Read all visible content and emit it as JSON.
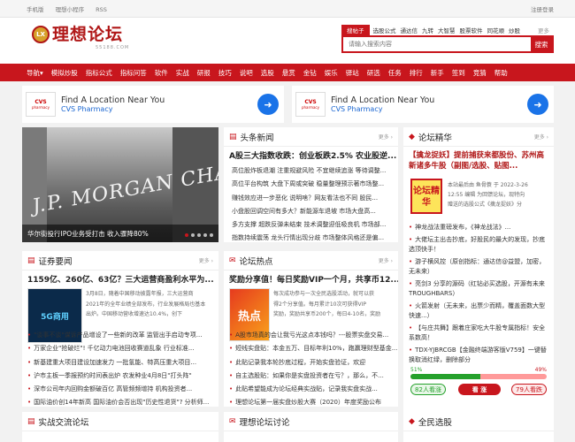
{
  "topbar": {
    "links": [
      "手机版",
      "理想小程序",
      "RSS"
    ],
    "right": "注册登录"
  },
  "logo": {
    "badge": "LX",
    "name": "理想论坛",
    "sub": "55188.COM"
  },
  "search": {
    "tabs": [
      "搜帖子",
      "选股公式",
      "通达信",
      "九转",
      "大智慧",
      "股票软件",
      "同花顺",
      "炒股"
    ],
    "more": "更多",
    "placeholder": "请输入搜索内容",
    "button": "搜索"
  },
  "nav": [
    "导航▾",
    "模拟炒股",
    "指标公式",
    "指标问答",
    "软件",
    "实战",
    "研报",
    "技巧",
    "说吧",
    "选股",
    "悬赏",
    "金钻",
    "娱乐",
    "驿站",
    "研选",
    "任务",
    "排行",
    "新手",
    "签到",
    "竞猜",
    "帮助"
  ],
  "ads": [
    {
      "logo": "CVS",
      "logo_sub": "pharmacy",
      "title": "Find A Location Near You",
      "sub": "CVS Pharmacy"
    },
    {
      "logo": "CVS",
      "logo_sub": "pharmacy",
      "title": "Find A Location Near You",
      "sub": "CVS Pharmacy"
    }
  ],
  "hero": {
    "text": "J.P. MORGAN CHASE & CO.",
    "caption": "华尔街投行IPO业务受打击 收入骤降80%"
  },
  "news": {
    "title": "头条新闻",
    "more": "更多 ›",
    "headline": "A股三大指数收跌：创业板跌2.5% 农业股逆...",
    "items": [
      "高位股炸板退潮 注重规避风险 不宜继续追涨 等待调整...",
      "高位平台构筑 大盘下周或突破 稳量整理预示著市场整...",
      "赚钱效应进一步恶化 说明啥？网友看法也不同 股民...",
      "小盘股回调空间有多大？新能源车退坡 市场大盘高...",
      "多方支撑 超跌反弹未结束 技术调整迎低吸良机 市场部...",
      "指数持续震荡 龙头行情出现分歧 市场整体风格还是偏..."
    ]
  },
  "elite": {
    "title": "论坛精华",
    "more": "更多 ›",
    "headline": "【擒龙捉妖】提前捕获来都股份、苏州高新诸多牛股（副图/选股、贴图...",
    "img": "论坛精华",
    "meta": [
      "本站最后由 鱼骨蓑 于 2022-3-26",
      "12:55 编辑 为回馈论坛，现特向",
      "赠送的选股公式《擒龙捉妖》分"
    ],
    "items": [
      "神龙战法重磅发布，《神龙战法》...",
      "大佬坛主出击抄底，好股民的最大的发现，抄底选顶快手！",
      "游子横风控（原创指标：通达信@益盟，加密，无未来）",
      "亮剑3 分享的源码（红钻必买选股，开源有未来TROUGHBARS）",
      "火箭发射（无未来，出票少而精，覆盖面数大型快速...）",
      "【与庄共舞】跟着庄家吃大牛股专属指标！安全系数高！",
      "TDX-YJBRCGB【金融终端游客版V759】一键替换取消红绿，删除部分"
    ],
    "progress": {
      "green": "51%",
      "red": "49%",
      "green_frac": 0.51
    },
    "buttons": {
      "left": "82人看涨",
      "mid": "看 涨",
      "right": "79人看跌"
    }
  },
  "sec": {
    "title": "证券要闻",
    "more": "更多 ›",
    "headline": "1159亿、260亿、63亿？三大运营商盈利水平为...",
    "img": "5G商用",
    "summary": [
      "3月8日，随着中国移动披露年报，三大运营商",
      "2021年的全年业绩全部发布，行业发展格局也基本",
      "出炉。中国移动营收增速达10.4%，创下"
    ],
    "items": [
      "\"谈事不谈\"谋诉产品增设了一些新的改革 监管出手启动专项...",
      "万家企业\"抢破烂\"! 千亿动力电池回收赛道乱象 行业标准...",
      "新基建重大项目建设加速发力 一批氢能、特高压重大项目...",
      "沪市主板一季报预约时间表出炉 农发种业4月8日\"打头阵\"",
      "深市公司年内回购金额破百亿 高管频频增持 机构投资者...",
      "国际油价创14年新高 国际油价会否出现\"历史性退货\"? 分析师..."
    ]
  },
  "hot": {
    "title": "论坛热点",
    "more": "更多 ›",
    "headline": "奖励分享值！每日奖励VIP一个月，共享币12...",
    "img": "热点",
    "summary": [
      "每次成功参与一次全民选股活动，就可以获",
      "得2个分享值。每月累计10次可获得VIP",
      "奖励，奖励共享币200个，每日4-10名，奖励"
    ],
    "items": [
      "A股市场真的会让我亏光这点本钱吗？---股票实盘交易...",
      "短线实盘贴：本金五万、目标年利10%，跑赢理财型基金...",
      "此贴记录我本轮抄底过程，开始实盘验证，欢迎",
      "自主选股贴：如果你是实盘投资者在亏？，那么，不...",
      "此贴希望能成为论坛经典实战贴，记录我实盘实战...",
      "理想论坛第一届实盘炒股大赛（2020）年度奖励公布"
    ]
  },
  "bottom": [
    "实战交流论坛",
    "理想论坛讨论",
    "全民选股"
  ]
}
